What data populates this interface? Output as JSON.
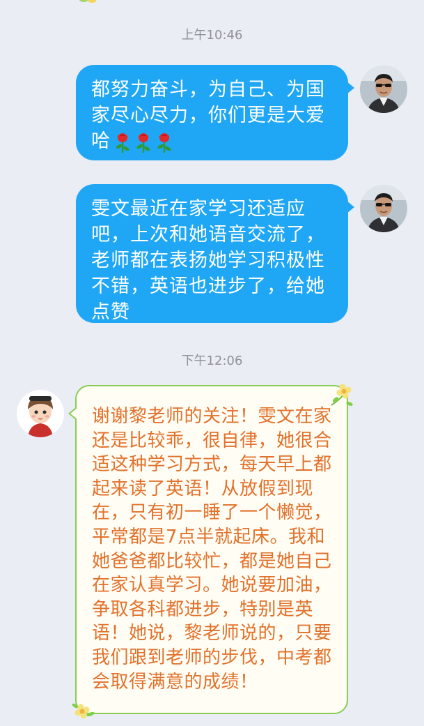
{
  "chat": {
    "messages": [
      {
        "time": "上午10:46",
        "from": "teacher",
        "text": "都努力奋斗，为自己、为国家尽心尽力，你们更是大爱哈",
        "emoji": [
          "rose-icon",
          "rose-icon",
          "rose-icon"
        ]
      },
      {
        "from": "teacher",
        "text": "雯文最近在家学习还适应吧，上次和她语音交流了，老师都在表扬她学习积极性不错，英语也进步了，给她点赞"
      },
      {
        "time": "下午12:06",
        "from": "parent",
        "text": "谢谢黎老师的关注！雯文在家还是比较乖，很自律，她很合适这种学习方式，每天早上都起来读了英语！从放假到现在，只有初一睡了一个懒觉，平常都是7点半就起床。我和她爸爸都比较忙，都是她自己在家认真学习。她说要加油，争取各科都进步，特别是英语！她说，黎老师说的，只要我们跟到老师的步伐，中考都会取得满意的成绩！"
      }
    ]
  },
  "colors": {
    "background": "#eaedf4",
    "outgoing_bubble": "#1fa7f5",
    "incoming_text": "#e2712b",
    "incoming_border": "#88cc55"
  }
}
